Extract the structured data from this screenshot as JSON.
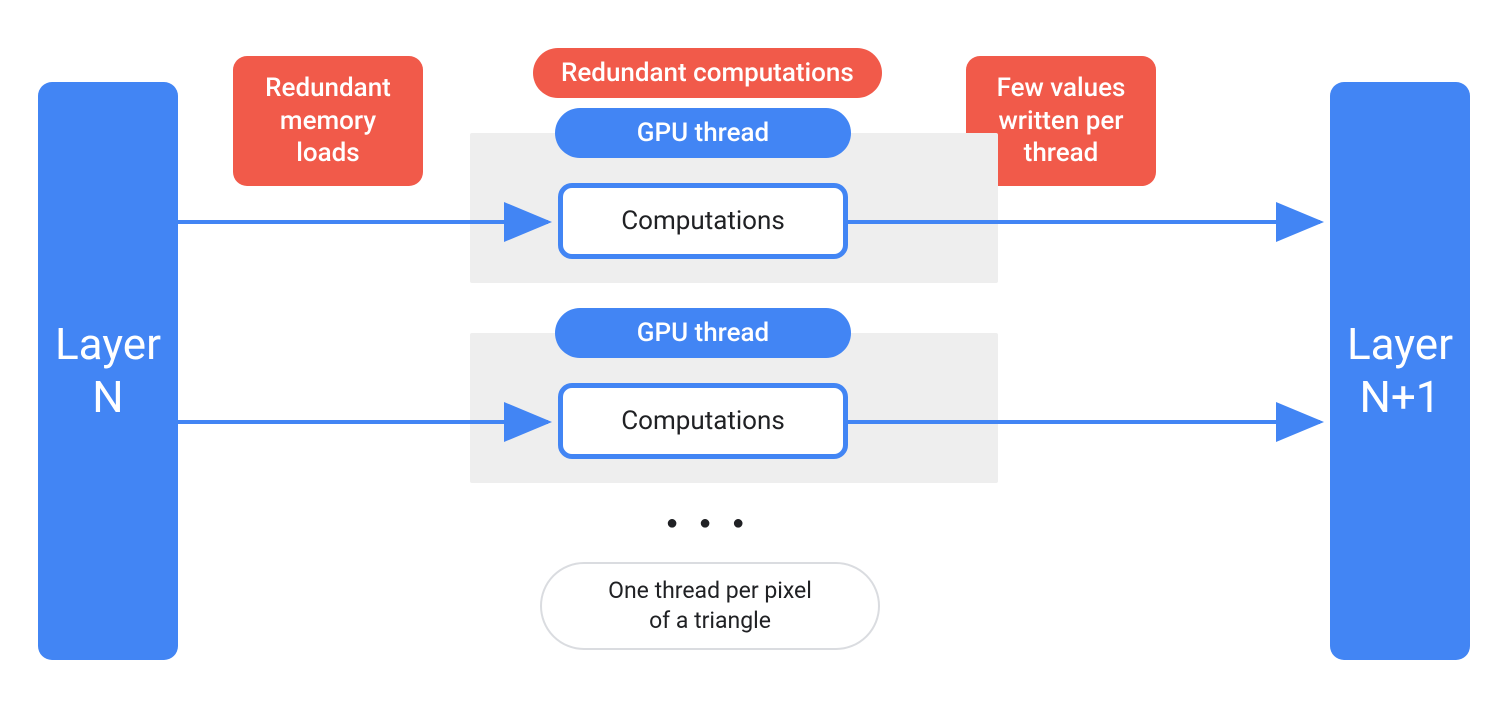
{
  "colors": {
    "blue": "#4285f4",
    "red": "#f15a4a",
    "grey_bg": "#eeeeee",
    "text_dark": "#202124"
  },
  "layer_left": "Layer\nN",
  "layer_right": "Layer\nN+1",
  "tag_redundant_memory": "Redundant\nmemory\nloads",
  "tag_redundant_computations": "Redundant computations",
  "tag_few_values": "Few values\nwritten per\nthread",
  "gpu_thread_label": "GPU thread",
  "computations_label": "Computations",
  "ellipsis": "● ● ●",
  "one_thread_caption": "One thread per pixel\nof a triangle"
}
